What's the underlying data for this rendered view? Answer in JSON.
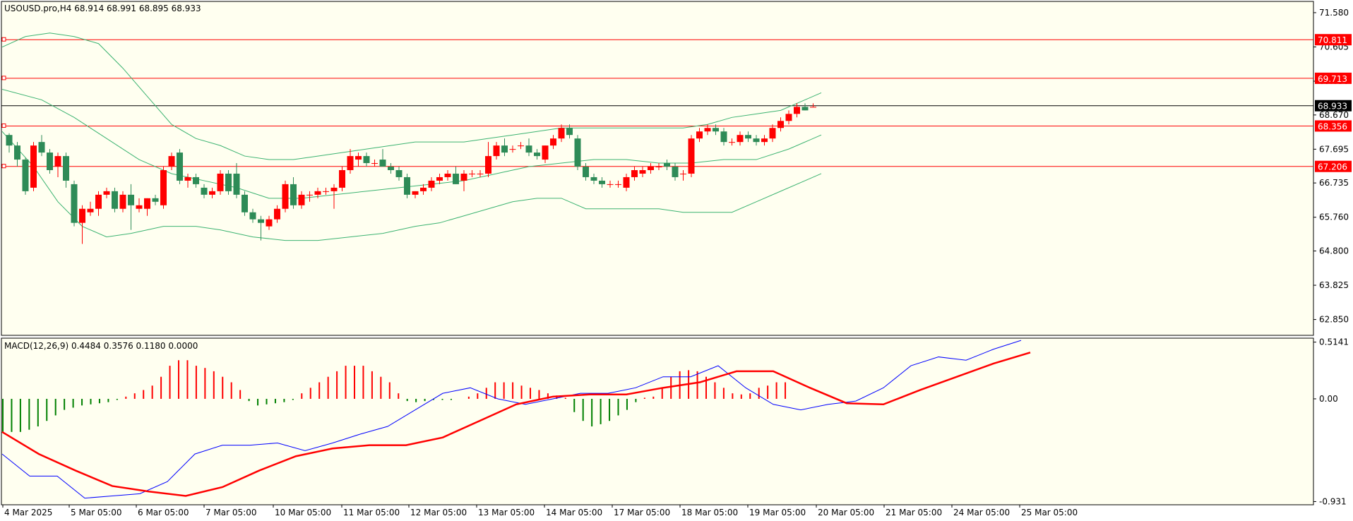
{
  "header": {
    "symbol_line": "USOUSD.pro,H4  68.914 68.991 68.895 68.933",
    "macd_line": "MACD(12,26,9) 0.4484 0.3576 0.1180 0.0000"
  },
  "colors": {
    "background": "#fffff0",
    "bull": "#2e8b57",
    "bear": "#ff0000",
    "bands": "#3cb371",
    "level": "#ff0000",
    "macd_main": "#0000ff",
    "macd_signal": "#ff0000",
    "current_price": "#000000"
  },
  "chart_data": [
    {
      "type": "candlestick",
      "ylim": [
        62.4,
        71.9
      ],
      "price_ticks": [
        "71.580",
        "70.605",
        "69.630",
        "68.670",
        "67.695",
        "66.735",
        "65.760",
        "64.800",
        "63.825",
        "62.850"
      ],
      "date_labels": [
        "4 Mar 2025",
        "5 Mar 05:00",
        "6 Mar 05:00",
        "7 Mar 05:00",
        "10 Mar 05:00",
        "11 Mar 05:00",
        "12 Mar 05:00",
        "13 Mar 05:00",
        "14 Mar 05:00",
        "17 Mar 05:00",
        "18 Mar 05:00",
        "19 Mar 05:00",
        "20 Mar 05:00",
        "21 Mar 05:00",
        "24 Mar 05:00",
        "25 Mar 05:00"
      ],
      "levels": [
        {
          "value": 70.811,
          "label": "70.811"
        },
        {
          "value": 69.713,
          "label": "69.713"
        },
        {
          "value": 68.356,
          "label": "68.356"
        },
        {
          "value": 67.206,
          "label": "67.206"
        }
      ],
      "current_price": {
        "value": 68.933,
        "label": "68.933"
      },
      "candles": [
        [
          68.1,
          68.15,
          67.6,
          67.8
        ],
        [
          67.8,
          67.9,
          67.2,
          67.4
        ],
        [
          67.4,
          67.45,
          66.4,
          66.5
        ],
        [
          66.6,
          67.9,
          66.5,
          67.8
        ],
        [
          67.9,
          68.1,
          67.5,
          67.6
        ],
        [
          67.6,
          67.7,
          67.0,
          67.1
        ],
        [
          67.2,
          67.6,
          66.9,
          67.5
        ],
        [
          67.5,
          67.6,
          66.6,
          66.8
        ],
        [
          66.7,
          66.8,
          65.5,
          65.6
        ],
        [
          65.6,
          66.1,
          65.0,
          66.0
        ],
        [
          65.9,
          66.2,
          65.8,
          66.0
        ],
        [
          66.0,
          66.5,
          65.8,
          66.4
        ],
        [
          66.4,
          66.6,
          66.3,
          66.5
        ],
        [
          66.5,
          66.6,
          65.9,
          66.0
        ],
        [
          66.0,
          66.5,
          65.9,
          66.4
        ],
        [
          66.4,
          66.7,
          65.4,
          66.1
        ],
        [
          66.0,
          66.3,
          65.9,
          66.1
        ],
        [
          66.0,
          66.3,
          65.8,
          66.3
        ],
        [
          66.3,
          66.4,
          66.1,
          66.2
        ],
        [
          66.1,
          67.2,
          66.0,
          67.1
        ],
        [
          67.2,
          67.6,
          67.1,
          67.5
        ],
        [
          67.6,
          67.7,
          66.7,
          66.8
        ],
        [
          66.8,
          67.0,
          66.6,
          66.9
        ],
        [
          66.9,
          67.0,
          66.6,
          66.7
        ],
        [
          66.6,
          66.7,
          66.3,
          66.4
        ],
        [
          66.4,
          66.6,
          66.3,
          66.5
        ],
        [
          66.5,
          67.1,
          66.4,
          67.0
        ],
        [
          67.0,
          67.1,
          66.4,
          66.5
        ],
        [
          67.0,
          67.3,
          66.3,
          66.4
        ],
        [
          66.4,
          66.5,
          65.8,
          65.9
        ],
        [
          65.9,
          66.0,
          65.6,
          65.7
        ],
        [
          65.7,
          65.8,
          65.1,
          65.6
        ],
        [
          65.5,
          65.8,
          65.4,
          65.7
        ],
        [
          65.7,
          66.1,
          65.6,
          66.0
        ],
        [
          66.0,
          66.8,
          65.9,
          66.7
        ],
        [
          66.7,
          66.9,
          66.0,
          66.1
        ],
        [
          66.1,
          66.5,
          66.0,
          66.4
        ],
        [
          66.4,
          66.5,
          66.2,
          66.4
        ],
        [
          66.4,
          66.6,
          66.3,
          66.5
        ],
        [
          66.5,
          66.6,
          66.4,
          66.5
        ],
        [
          66.5,
          66.7,
          66.0,
          66.6
        ],
        [
          66.6,
          67.2,
          66.5,
          67.1
        ],
        [
          67.1,
          67.7,
          67.0,
          67.5
        ],
        [
          67.4,
          67.6,
          67.2,
          67.5
        ],
        [
          67.5,
          67.6,
          67.2,
          67.3
        ],
        [
          67.3,
          67.4,
          67.2,
          67.3
        ],
        [
          67.4,
          67.7,
          67.2,
          67.2
        ],
        [
          67.2,
          67.3,
          67.0,
          67.1
        ],
        [
          67.1,
          67.2,
          66.8,
          66.9
        ],
        [
          66.9,
          67.0,
          66.3,
          66.4
        ],
        [
          66.4,
          66.5,
          66.3,
          66.5
        ],
        [
          66.5,
          66.7,
          66.4,
          66.6
        ],
        [
          66.6,
          66.9,
          66.5,
          66.8
        ],
        [
          66.8,
          67.0,
          66.7,
          66.9
        ],
        [
          66.9,
          67.1,
          66.8,
          67.0
        ],
        [
          67.0,
          67.2,
          66.7,
          66.7
        ],
        [
          66.8,
          67.1,
          66.5,
          67.0
        ],
        [
          67.0,
          67.1,
          66.9,
          67.0
        ],
        [
          67.0,
          67.1,
          66.9,
          67.0
        ],
        [
          67.0,
          67.9,
          66.9,
          67.5
        ],
        [
          67.5,
          67.9,
          67.4,
          67.8
        ],
        [
          67.8,
          68.0,
          67.5,
          67.6
        ],
        [
          67.7,
          67.8,
          67.6,
          67.7
        ],
        [
          67.8,
          67.9,
          67.7,
          67.8
        ],
        [
          67.8,
          68.0,
          67.5,
          67.6
        ],
        [
          67.6,
          67.7,
          67.4,
          67.5
        ],
        [
          67.4,
          67.8,
          67.3,
          67.8
        ],
        [
          67.8,
          68.1,
          67.7,
          68.0
        ],
        [
          68.0,
          68.4,
          67.9,
          68.3
        ],
        [
          68.3,
          68.4,
          68.0,
          68.1
        ],
        [
          68.0,
          68.1,
          67.1,
          67.2
        ],
        [
          67.2,
          67.3,
          66.8,
          66.9
        ],
        [
          66.9,
          67.0,
          66.7,
          66.8
        ],
        [
          66.8,
          66.9,
          66.6,
          66.7
        ],
        [
          66.7,
          66.8,
          66.6,
          66.7
        ],
        [
          66.7,
          66.8,
          66.6,
          66.7
        ],
        [
          66.6,
          67.0,
          66.5,
          66.9
        ],
        [
          66.9,
          67.2,
          66.8,
          67.1
        ],
        [
          67.0,
          67.2,
          66.9,
          67.1
        ],
        [
          67.1,
          67.3,
          67.0,
          67.2
        ],
        [
          67.2,
          67.3,
          67.1,
          67.2
        ],
        [
          67.3,
          67.4,
          67.1,
          67.2
        ],
        [
          67.2,
          67.3,
          66.8,
          66.9
        ],
        [
          67.0,
          67.1,
          66.8,
          67.0
        ],
        [
          67.0,
          68.1,
          66.9,
          68.0
        ],
        [
          68.0,
          68.3,
          67.9,
          68.2
        ],
        [
          68.2,
          68.4,
          68.1,
          68.3
        ],
        [
          68.3,
          68.4,
          68.1,
          68.2
        ],
        [
          68.2,
          68.3,
          67.8,
          67.9
        ],
        [
          67.9,
          68.0,
          67.8,
          67.9
        ],
        [
          67.9,
          68.2,
          67.8,
          68.1
        ],
        [
          68.1,
          68.2,
          67.9,
          68.0
        ],
        [
          68.0,
          68.1,
          67.8,
          67.9
        ],
        [
          67.9,
          68.1,
          67.8,
          68.0
        ],
        [
          68.0,
          68.4,
          67.9,
          68.3
        ],
        [
          68.3,
          68.6,
          68.2,
          68.5
        ],
        [
          68.5,
          68.8,
          68.4,
          68.7
        ],
        [
          68.7,
          69.0,
          68.6,
          68.9
        ],
        [
          68.9,
          69.0,
          68.8,
          68.8
        ],
        [
          68.9,
          69.0,
          68.9,
          68.9
        ]
      ],
      "bb_upper": [
        [
          0,
          70.6
        ],
        [
          2,
          70.9
        ],
        [
          5,
          71.0
        ],
        [
          8,
          70.9
        ],
        [
          11,
          70.7
        ],
        [
          14,
          70.0
        ],
        [
          17,
          69.2
        ],
        [
          20,
          68.4
        ],
        [
          23,
          68.0
        ],
        [
          26,
          67.8
        ],
        [
          29,
          67.5
        ],
        [
          32,
          67.4
        ],
        [
          35,
          67.4
        ],
        [
          38,
          67.5
        ],
        [
          41,
          67.6
        ],
        [
          44,
          67.7
        ],
        [
          47,
          67.8
        ],
        [
          50,
          67.9
        ],
        [
          53,
          67.9
        ],
        [
          56,
          67.9
        ],
        [
          59,
          68.0
        ],
        [
          62,
          68.1
        ],
        [
          65,
          68.2
        ],
        [
          68,
          68.3
        ],
        [
          71,
          68.3
        ],
        [
          74,
          68.3
        ],
        [
          77,
          68.3
        ],
        [
          80,
          68.3
        ],
        [
          83,
          68.3
        ],
        [
          86,
          68.4
        ],
        [
          89,
          68.6
        ],
        [
          92,
          68.7
        ],
        [
          95,
          68.8
        ],
        [
          98,
          69.1
        ],
        [
          100,
          69.3
        ]
      ],
      "bb_middle": [
        [
          0,
          69.4
        ],
        [
          4,
          69.1
        ],
        [
          8,
          68.6
        ],
        [
          12,
          68.0
        ],
        [
          16,
          67.4
        ],
        [
          20,
          67.0
        ],
        [
          24,
          66.8
        ],
        [
          28,
          66.6
        ],
        [
          32,
          66.3
        ],
        [
          36,
          66.3
        ],
        [
          40,
          66.4
        ],
        [
          44,
          66.5
        ],
        [
          48,
          66.6
        ],
        [
          52,
          66.7
        ],
        [
          56,
          66.8
        ],
        [
          60,
          67.0
        ],
        [
          64,
          67.2
        ],
        [
          68,
          67.3
        ],
        [
          72,
          67.4
        ],
        [
          76,
          67.4
        ],
        [
          80,
          67.3
        ],
        [
          84,
          67.3
        ],
        [
          88,
          67.4
        ],
        [
          92,
          67.4
        ],
        [
          96,
          67.7
        ],
        [
          100,
          68.1
        ]
      ],
      "bb_lower": [
        [
          0,
          68.2
        ],
        [
          3,
          67.2
        ],
        [
          6,
          66.2
        ],
        [
          9,
          65.5
        ],
        [
          12,
          65.2
        ],
        [
          15,
          65.3
        ],
        [
          19,
          65.5
        ],
        [
          23,
          65.5
        ],
        [
          26,
          65.4
        ],
        [
          30,
          65.2
        ],
        [
          34,
          65.1
        ],
        [
          38,
          65.1
        ],
        [
          42,
          65.2
        ],
        [
          46,
          65.3
        ],
        [
          50,
          65.5
        ],
        [
          53,
          65.6
        ],
        [
          56,
          65.8
        ],
        [
          59,
          66.0
        ],
        [
          62,
          66.2
        ],
        [
          65,
          66.3
        ],
        [
          68,
          66.3
        ],
        [
          71,
          66.0
        ],
        [
          74,
          66.0
        ],
        [
          77,
          66.0
        ],
        [
          80,
          66.0
        ],
        [
          83,
          65.9
        ],
        [
          86,
          65.9
        ],
        [
          89,
          65.9
        ],
        [
          92,
          66.2
        ],
        [
          95,
          66.5
        ],
        [
          98,
          66.8
        ],
        [
          100,
          67.0
        ]
      ]
    },
    {
      "type": "macd",
      "ylim": [
        -0.96,
        0.55
      ],
      "y_ticks": [
        "0.5141",
        "0.00",
        "-0.931"
      ],
      "main": [
        [
          0,
          -0.5
        ],
        [
          3,
          -0.7
        ],
        [
          6,
          -0.7
        ],
        [
          9,
          -0.9
        ],
        [
          12,
          -0.88
        ],
        [
          15,
          -0.86
        ],
        [
          18,
          -0.75
        ],
        [
          21,
          -0.5
        ],
        [
          24,
          -0.42
        ],
        [
          27,
          -0.42
        ],
        [
          30,
          -0.4
        ],
        [
          33,
          -0.47
        ],
        [
          36,
          -0.4
        ],
        [
          39,
          -0.32
        ],
        [
          42,
          -0.25
        ],
        [
          45,
          -0.1
        ],
        [
          48,
          0.05
        ],
        [
          51,
          0.1
        ],
        [
          54,
          0.0
        ],
        [
          57,
          -0.05
        ],
        [
          60,
          0.0
        ],
        [
          63,
          0.05
        ],
        [
          66,
          0.05
        ],
        [
          69,
          0.1
        ],
        [
          72,
          0.2
        ],
        [
          75,
          0.2
        ],
        [
          78,
          0.3
        ],
        [
          81,
          0.1
        ],
        [
          84,
          -0.05
        ],
        [
          87,
          -0.1
        ],
        [
          90,
          -0.05
        ],
        [
          93,
          -0.02
        ],
        [
          96,
          0.1
        ],
        [
          99,
          0.3
        ],
        [
          102,
          0.38
        ],
        [
          105,
          0.35
        ],
        [
          108,
          0.45
        ],
        [
          111,
          0.53
        ]
      ],
      "signal": [
        [
          0,
          -0.3
        ],
        [
          4,
          -0.5
        ],
        [
          8,
          -0.65
        ],
        [
          12,
          -0.79
        ],
        [
          16,
          -0.84
        ],
        [
          20,
          -0.88
        ],
        [
          24,
          -0.8
        ],
        [
          28,
          -0.65
        ],
        [
          32,
          -0.52
        ],
        [
          36,
          -0.45
        ],
        [
          40,
          -0.42
        ],
        [
          44,
          -0.42
        ],
        [
          48,
          -0.35
        ],
        [
          52,
          -0.2
        ],
        [
          56,
          -0.05
        ],
        [
          60,
          0.02
        ],
        [
          64,
          0.04
        ],
        [
          68,
          0.04
        ],
        [
          72,
          0.1
        ],
        [
          76,
          0.15
        ],
        [
          80,
          0.25
        ],
        [
          84,
          0.25
        ],
        [
          88,
          0.1
        ],
        [
          92,
          -0.04
        ],
        [
          96,
          -0.05
        ],
        [
          100,
          0.08
        ],
        [
          104,
          0.2
        ],
        [
          108,
          0.32
        ],
        [
          112,
          0.42
        ]
      ],
      "histogram": [
        -0.3,
        -0.3,
        -0.3,
        -0.28,
        -0.25,
        -0.2,
        -0.15,
        -0.1,
        -0.08,
        -0.06,
        -0.05,
        -0.04,
        -0.03,
        -0.01,
        0.02,
        0.05,
        0.08,
        0.12,
        0.2,
        0.3,
        0.35,
        0.35,
        0.3,
        0.28,
        0.25,
        0.2,
        0.15,
        0.08,
        -0.02,
        -0.06,
        -0.05,
        -0.04,
        -0.03,
        -0.01,
        0.05,
        0.1,
        0.15,
        0.2,
        0.25,
        0.3,
        0.3,
        0.3,
        0.25,
        0.2,
        0.15,
        0.05,
        -0.02,
        -0.03,
        -0.02,
        -0.01,
        -0.01,
        -0.01,
        0.0,
        0.02,
        0.05,
        0.1,
        0.15,
        0.15,
        0.15,
        0.12,
        0.1,
        0.08,
        0.05,
        0.03,
        0.01,
        -0.12,
        -0.2,
        -0.25,
        -0.23,
        -0.2,
        -0.15,
        -0.1,
        -0.03,
        0.01,
        0.02,
        0.1,
        0.2,
        0.25,
        0.26,
        0.25,
        0.2,
        0.15,
        0.1,
        0.05,
        0.04,
        0.05,
        0.1,
        0.12,
        0.15,
        0.15
      ]
    }
  ]
}
